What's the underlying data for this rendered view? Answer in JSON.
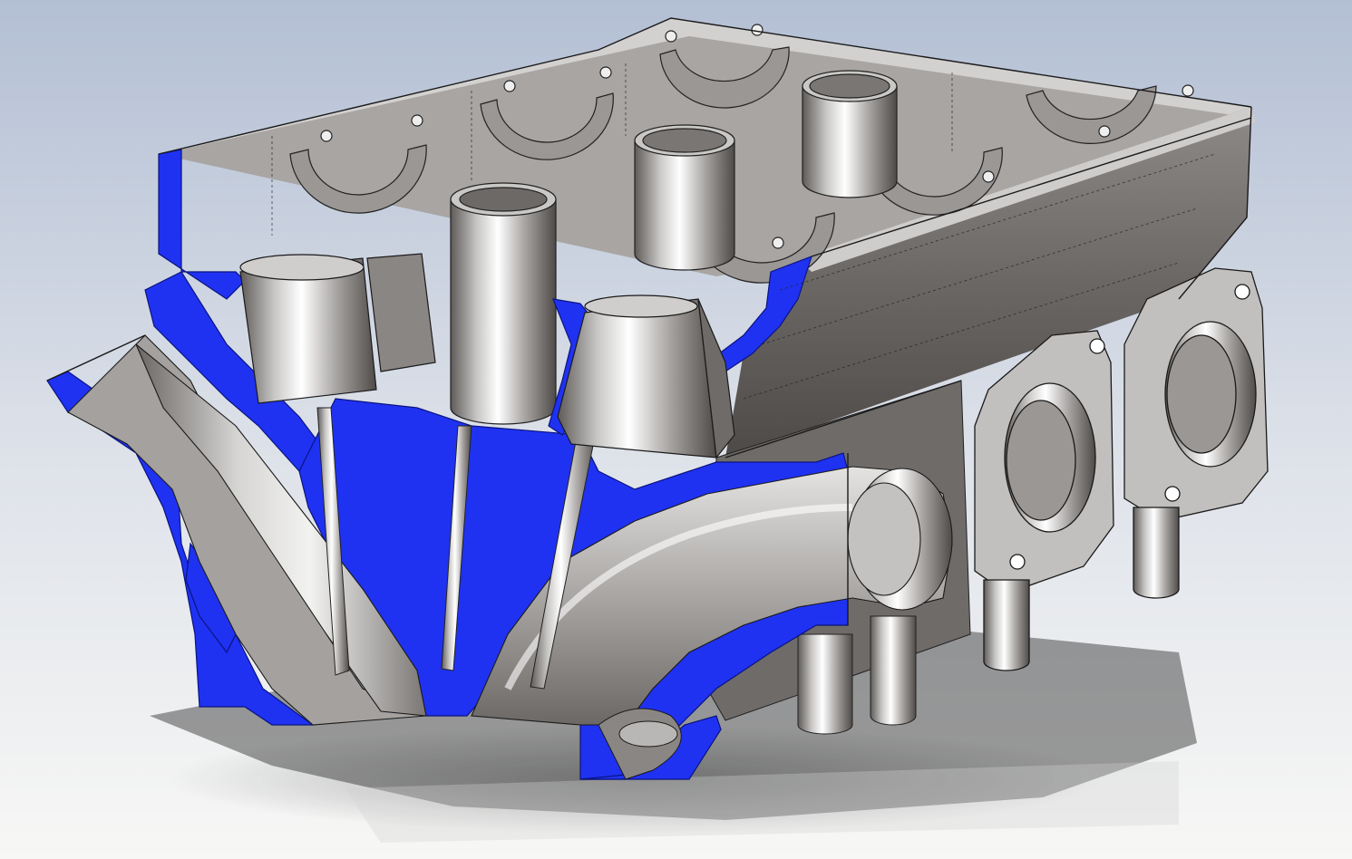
{
  "scene": {
    "subject": "engine-cylinder-head-section-view",
    "colors": {
      "background_top": "#b7c2d6",
      "background_bottom": "#f6f6f4",
      "section_fill": "#1f32f2",
      "section_fill_dark": "#1526c8",
      "metal_light": "#d9d8d6",
      "metal_mid": "#a8a5a3",
      "metal_dark": "#5f5b59",
      "edge_line": "#1a1a1a",
      "shadow": "#3a3a3a"
    }
  }
}
